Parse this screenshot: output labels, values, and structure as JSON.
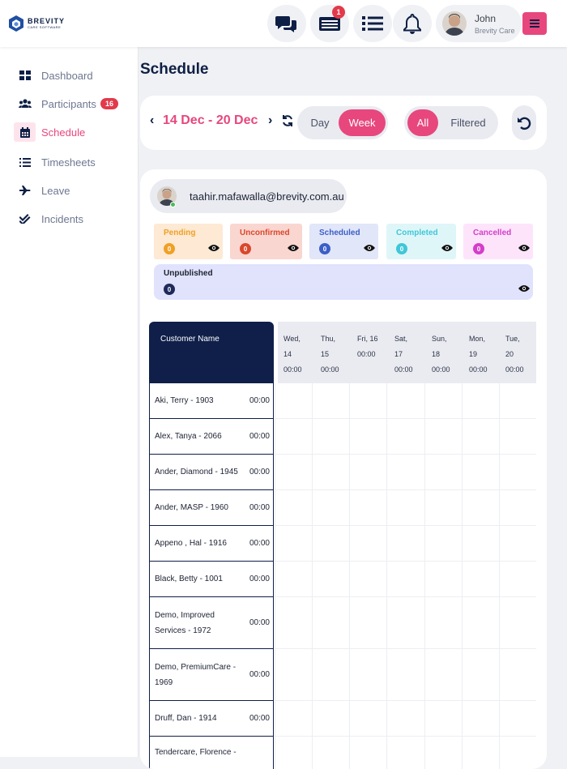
{
  "logo": {
    "name": "BREVITY",
    "subtitle": "CARE SOFTWARE"
  },
  "topbar": {
    "icons": [
      {
        "name": "chat-icon"
      },
      {
        "name": "inbox-icon",
        "badge": "1"
      },
      {
        "name": "list-icon"
      },
      {
        "name": "bell-icon"
      }
    ],
    "user": {
      "name": "John",
      "role": "Brevity Care"
    }
  },
  "sidebar": {
    "items": [
      {
        "label": "Dashboard",
        "icon": "dashboard-icon"
      },
      {
        "label": "Participants",
        "icon": "users-icon",
        "badge": "16"
      },
      {
        "label": "Schedule",
        "icon": "calendar-icon",
        "active": true
      },
      {
        "label": "Timesheets",
        "icon": "list-icon"
      },
      {
        "label": "Leave",
        "icon": "plane-icon"
      },
      {
        "label": "Incidents",
        "icon": "check-double-icon"
      }
    ]
  },
  "page": {
    "title": "Schedule"
  },
  "toolbar": {
    "date_range": "14 Dec - 20 Dec",
    "view_options": [
      "Day",
      "Week"
    ],
    "view_selected": "Week",
    "filter_options": [
      "All",
      "Filtered"
    ],
    "filter_selected": "All"
  },
  "staff": {
    "email": "taahir.mafawalla@brevity.com.au"
  },
  "statuses": [
    {
      "label": "Pending",
      "count": "0",
      "bg": "#fde9d4",
      "fg": "#f0a025",
      "dot": "#f0a025"
    },
    {
      "label": "Unconfirmed",
      "count": "0",
      "bg": "#fad6d0",
      "fg": "#d9482b",
      "dot": "#d9482b"
    },
    {
      "label": "Scheduled",
      "count": "0",
      "bg": "#e1e6f9",
      "fg": "#3b5fc7",
      "dot": "#3b5fc7"
    },
    {
      "label": "Completed",
      "count": "0",
      "bg": "#dff6f8",
      "fg": "#3fc7d9",
      "dot": "#3fc7d9"
    },
    {
      "label": "Cancelled",
      "count": "0",
      "bg": "#fde4fb",
      "fg": "#d43ec9",
      "dot": "#d43ec9"
    },
    {
      "label": "Unpublished",
      "count": "0",
      "bg": "#e0e3fb",
      "fg": "#1d2233",
      "dot": "#1f2a5c"
    }
  ],
  "grid": {
    "customer_header": "Customer Name",
    "days": [
      {
        "day": "Wed,",
        "date": "14",
        "time": "00:00"
      },
      {
        "day": "Thu,",
        "date": "15",
        "time": "00:00"
      },
      {
        "day": "Fri, 16",
        "date": "",
        "time": "00:00"
      },
      {
        "day": "Sat,",
        "date": "17",
        "time": "00:00"
      },
      {
        "day": "Sun,",
        "date": "18",
        "time": "00:00"
      },
      {
        "day": "Mon,",
        "date": "19",
        "time": "00:00"
      },
      {
        "day": "Tue,",
        "date": "20",
        "time": "00:00"
      }
    ],
    "customers": [
      {
        "name": "Aki, Terry - 1903",
        "time": "00:00"
      },
      {
        "name": "Alex, Tanya - 2066",
        "time": "00:00"
      },
      {
        "name": "Ander, Diamond - 1945",
        "time": "00:00"
      },
      {
        "name": "Ander, MASP - 1960",
        "time": "00:00"
      },
      {
        "name": "Appeno , Hal - 1916",
        "time": "00:00"
      },
      {
        "name": "Black, Betty - 1001",
        "time": "00:00"
      },
      {
        "name": "Demo, Improved Services - 1972",
        "time": "00:00"
      },
      {
        "name": "Demo, PremiumCare - 1969",
        "time": "00:00"
      },
      {
        "name": "Druff, Dan - 1914",
        "time": "00:00"
      },
      {
        "name": "Tendercare, Florence -",
        "time": ""
      }
    ]
  }
}
